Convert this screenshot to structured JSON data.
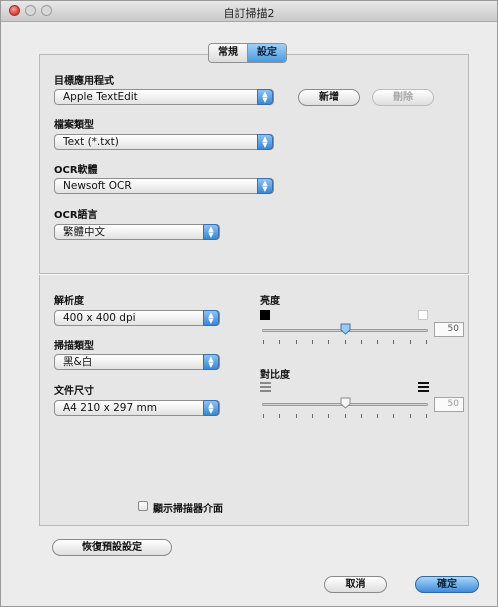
{
  "window": {
    "title": "自訂掃描2"
  },
  "tabs": [
    {
      "label": "常規"
    },
    {
      "label": "設定"
    }
  ],
  "target_app": {
    "label": "目標應用程式",
    "value": "Apple TextEdit",
    "add_button": "新增",
    "delete_button": "刪除"
  },
  "file_type": {
    "label": "檔案類型",
    "value": "Text (*.txt)"
  },
  "ocr_software": {
    "label": "OCR軟體",
    "value": "Newsoft OCR"
  },
  "ocr_language": {
    "label": "OCR語言",
    "value": "繁體中文"
  },
  "resolution": {
    "label": "解析度",
    "value": "400 x 400 dpi"
  },
  "scan_type": {
    "label": "掃描類型",
    "value": "黑&白"
  },
  "document_size": {
    "label": "文件尺寸",
    "value": "A4 210 x 297 mm"
  },
  "brightness": {
    "label": "亮度",
    "value": "50",
    "level": 50
  },
  "contrast": {
    "label": "對比度",
    "value": "50",
    "level": 50
  },
  "show_scanner_interface": {
    "label": "顯示掃描器介面",
    "checked": false
  },
  "restore_defaults_button": "恢復預設設定",
  "cancel_button": "取消",
  "ok_button": "確定"
}
